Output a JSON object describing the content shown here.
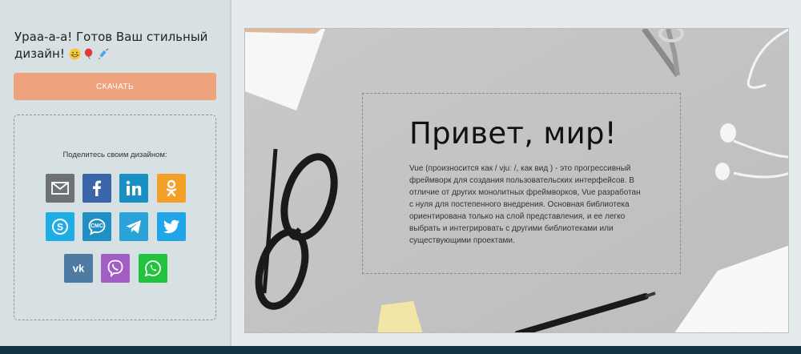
{
  "sidebar": {
    "headline": "Ураа-а-а! Готов Ваш стильный дизайн!",
    "emojis": [
      "grinning-face-icon",
      "balloon-icon",
      "syringe-icon"
    ],
    "download_label": "СКАЧАТЬ",
    "share_title": "Поделитесь своим дизайном:",
    "share_buttons": [
      {
        "name": "email",
        "color": "#6e7275"
      },
      {
        "name": "facebook",
        "color": "#3a66a8"
      },
      {
        "name": "linkedin",
        "color": "#1a8fc4"
      },
      {
        "name": "odnoklassniki",
        "color": "#f3a029"
      },
      {
        "name": "skype",
        "color": "#1daee8"
      },
      {
        "name": "sms",
        "color": "#1f8fc6"
      },
      {
        "name": "telegram",
        "color": "#2aa3d8"
      },
      {
        "name": "twitter",
        "color": "#1fa5e8"
      },
      {
        "name": "vk",
        "color": "#4f7ba2"
      },
      {
        "name": "viber",
        "color": "#a25ec4"
      },
      {
        "name": "whatsapp",
        "color": "#22c33f"
      }
    ],
    "sms_label": "СМС"
  },
  "canvas": {
    "heading": "Привет, мир!",
    "description": "Vue (произносится как / vjuː /, как вид ) - это прогрессивный фреймворк для создания пользовательских интерфейсов. В отличие от других монолитных фреймворков, Vue разработан с нуля для постепенного внедрения. Основная библиотека ориентирована только на слой представления, и ее легко выбрать и интегрировать с другими библиотеками или существующими проектами."
  },
  "colors": {
    "accent": "#eea37c",
    "footer": "#123243"
  }
}
